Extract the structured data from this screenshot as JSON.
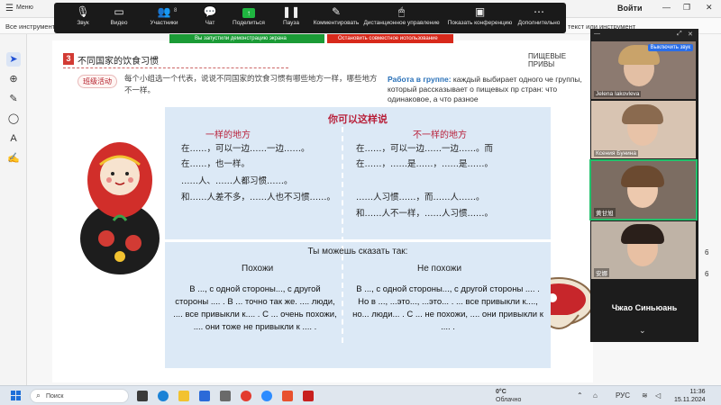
{
  "app": {
    "menu_label": "Меню",
    "title": "Войти",
    "all_tools": "Все инструменты",
    "tools_right": "текст или инструмент"
  },
  "doc": {
    "section_number": "3",
    "section_title": "不同国家的饮食习惯",
    "right_header": "ПИЩЕВЫЕ ПРИВЫ",
    "badge": "班级活动",
    "instruction_cn": "每个小组选一个代表，说说不同国家的饮食习惯有哪些地方一样，哪些地方不一样。",
    "instruction_ru_bold": "Работа в группе:",
    "instruction_ru": "каждый выбирает одного че группы, который рассказывает о пищевых пр стран: что одинаковое, а что разное",
    "panel_title": "你可以这样说",
    "same_head": "一样的地方",
    "diff_head": "不一样的地方",
    "same_lines": [
      "在……，可以一边……一边……。在……，也一样。",
      "……人、……人都习惯……。",
      "和……人差不多，……人也不习惯……。"
    ],
    "diff_lines": [
      "在……，可以一边……一边……。而在……，……是……，……是……。",
      "……人习惯……，而……人……。",
      "和……人不一样，……人习惯……。"
    ],
    "ru_title": "Ты можешь сказать так:",
    "ru_same_head": "Похожи",
    "ru_diff_head": "Не похожи",
    "ru_same_text": "В ..., с одной стороны..., с другой стороны .... . В ... точно так же. .... люди, .... все привыкли к.... . С ... очень похожи, .... они тоже не привыкли к .... .",
    "ru_diff_text": "В ..., с одной стороны..., с другой стороны .... . Но в ..., ...это..., ...это... . ... все привыкли к...., но... люди... . С ... не похожи, .... они привыкли к .... ."
  },
  "zoom": {
    "toolbar": [
      {
        "label": "Звук",
        "icon": "microphone-icon"
      },
      {
        "label": "Видео",
        "icon": "video-camera-icon"
      },
      {
        "label": "Участники",
        "icon": "participants-icon"
      },
      {
        "label": "Чат",
        "icon": "chat-icon"
      },
      {
        "label": "Поделиться",
        "icon": "share-screen-icon"
      },
      {
        "label": "Пауза",
        "icon": "pause-icon"
      },
      {
        "label": "Комментировать",
        "icon": "annotate-pen-icon"
      },
      {
        "label": "Дистанционное управление",
        "icon": "remote-control-icon"
      },
      {
        "label": "Показать конференцию",
        "icon": "show-meeting-icon"
      },
      {
        "label": "Дополнительно",
        "icon": "more-icon"
      }
    ],
    "participant_count": "8",
    "demo_notice": "Вы запустили демонстрацию экрана",
    "stop_share": "Остановить совместное использование",
    "stop_video": "Выключить звук",
    "participants": [
      {
        "name": "Jelena Iakovleva"
      },
      {
        "name": "Ксения Бунина"
      },
      {
        "name": "黄甘旭"
      },
      {
        "name": "安娜"
      }
    ],
    "speaker": "Чжао Синьюань"
  },
  "pages": {
    "current": "6",
    "total": "6"
  },
  "taskbar": {
    "search_label": "Поиск",
    "temperature": "0°C",
    "weather": "Облачно",
    "lang": "РУС",
    "time": "11:36",
    "date": "15.11.2024"
  },
  "colors": {
    "accent_red": "#b8203a",
    "zoom_green": "#1b9b36",
    "panel_blue": "#dce9f6"
  }
}
